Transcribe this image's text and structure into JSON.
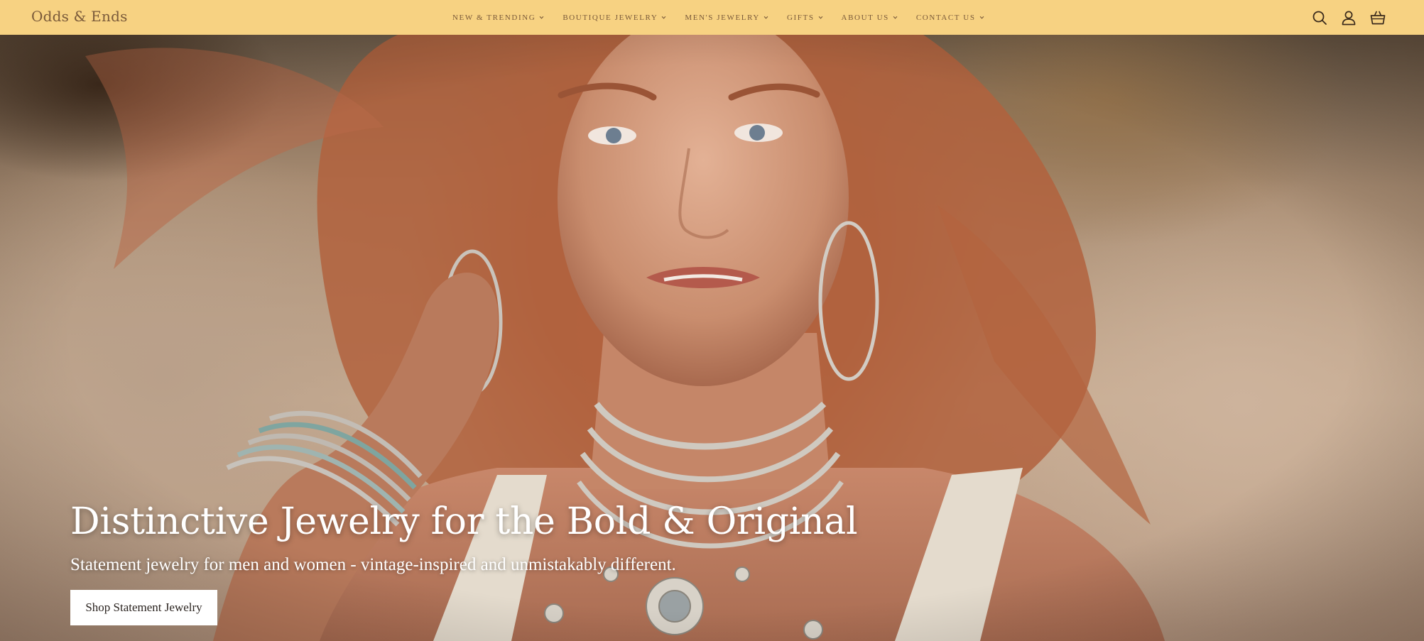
{
  "brand": {
    "name": "Odds & Ends"
  },
  "nav": {
    "items": [
      {
        "label": "New & Trending",
        "icon": "chevron-down-icon"
      },
      {
        "label": "Boutique Jewelry",
        "icon": "chevron-down-icon"
      },
      {
        "label": "Men's Jewelry",
        "icon": "chevron-down-icon"
      },
      {
        "label": "Gifts",
        "icon": "chevron-down-icon"
      },
      {
        "label": "About Us",
        "icon": "chevron-down-icon"
      },
      {
        "label": "Contact Us",
        "icon": "chevron-down-icon"
      }
    ]
  },
  "header_icons": [
    "search-icon",
    "account-icon",
    "cart-icon"
  ],
  "hero": {
    "title": "Distinctive Jewelry for the Bold & Original",
    "subtitle": "Statement jewelry for men and women - vintage-inspired and unmistakably different.",
    "cta_label": "Shop Statement Jewelry"
  },
  "colors": {
    "header_bg": "#f7d282",
    "header_text": "#7a5a3a",
    "hero_text": "#ffffff",
    "cta_bg": "#ffffff",
    "cta_text": "#2b2420"
  }
}
